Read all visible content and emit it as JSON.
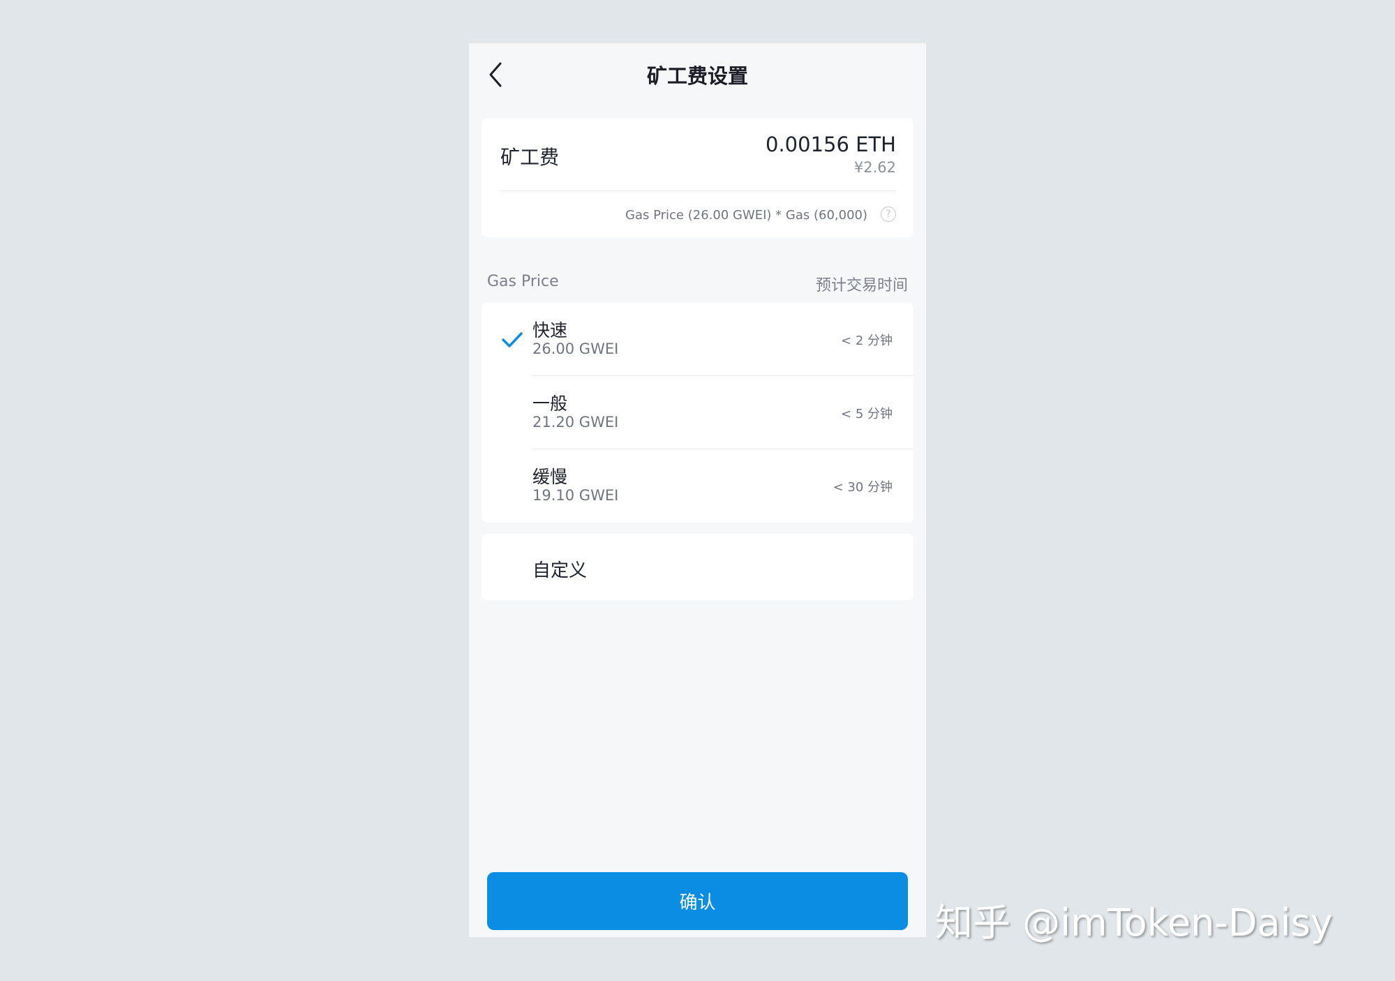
{
  "header": {
    "title": "矿工费设置",
    "back_icon": "chevron-left-icon"
  },
  "fee_summary": {
    "label": "矿工费",
    "eth_amount": "0.00156 ETH",
    "cny_amount": "¥2.62",
    "formula": "Gas Price (26.00 GWEI) * Gas (60,000)",
    "help_glyph": "?"
  },
  "gas_section": {
    "left_label": "Gas Price",
    "right_label": "预计交易时间"
  },
  "options": [
    {
      "name": "快速",
      "gwei": "26.00 GWEI",
      "time": "< 2 分钟",
      "selected": true
    },
    {
      "name": "一般",
      "gwei": "21.20 GWEI",
      "time": "< 5 分钟",
      "selected": false
    },
    {
      "name": "缓慢",
      "gwei": "19.10 GWEI",
      "time": "< 30 分钟",
      "selected": false
    }
  ],
  "custom": {
    "label": "自定义"
  },
  "confirm_button": {
    "label": "确认"
  },
  "watermark": {
    "text": "知乎 @imToken-Daisy"
  },
  "colors": {
    "accent": "#0b8de3",
    "background": "#e1e6ea",
    "page": "#f6f7f9"
  }
}
